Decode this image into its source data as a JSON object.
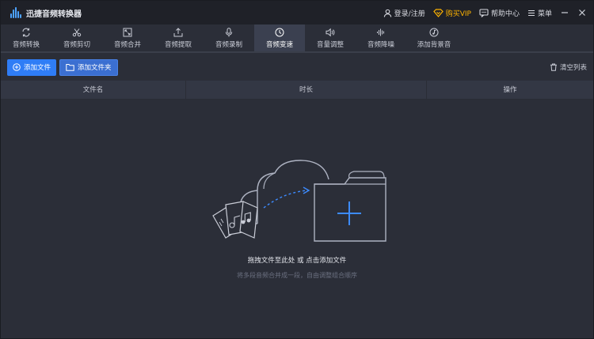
{
  "app": {
    "title": "迅捷音频转换器"
  },
  "titlebar": {
    "login": "登录/注册",
    "vip": "购买VIP",
    "help": "帮助中心",
    "menu": "菜单"
  },
  "toolbar": {
    "items": [
      {
        "label": "音频转换",
        "icon": "convert-icon"
      },
      {
        "label": "音频剪切",
        "icon": "scissors-icon"
      },
      {
        "label": "音频合并",
        "icon": "merge-icon"
      },
      {
        "label": "音频提取",
        "icon": "extract-icon"
      },
      {
        "label": "音频录制",
        "icon": "mic-icon"
      },
      {
        "label": "音频变速",
        "icon": "speed-icon"
      },
      {
        "label": "音量调整",
        "icon": "volume-icon"
      },
      {
        "label": "音频降噪",
        "icon": "noise-icon"
      },
      {
        "label": "添加背景音",
        "icon": "music-note-icon"
      }
    ],
    "active_index": 5
  },
  "actions": {
    "add_file": "添加文件",
    "add_folder": "添加文件夹",
    "clear_list": "清空列表"
  },
  "table": {
    "columns": [
      "文件名",
      "时长",
      "操作"
    ]
  },
  "empty": {
    "main": "拖拽文件至此处 或 点击添加文件",
    "sub": "将多段音频合并成一段，自由调整组合顺序"
  },
  "colors": {
    "accent": "#2f7df6",
    "vip": "#ffb400",
    "background": "#2b2e38",
    "titlebar": "#1f2128"
  }
}
